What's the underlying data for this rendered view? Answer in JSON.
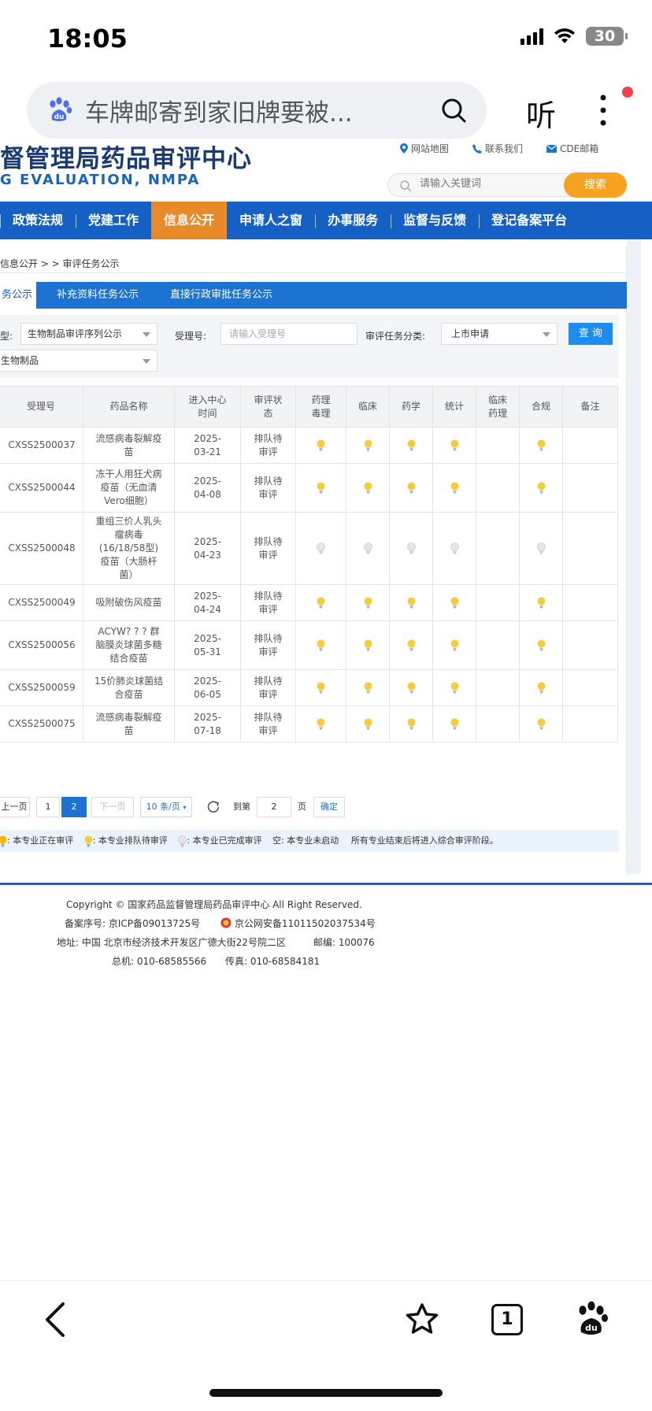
{
  "status": {
    "time": "18:05",
    "battery": "30"
  },
  "browser": {
    "search_query": "车牌邮寄到家旧牌要被...",
    "listen_label": "听"
  },
  "site": {
    "title": "督管理局药品审评中心",
    "subtitle": "G EVALUATION, NMPA",
    "links": [
      "网站地图",
      "联系我们",
      "CDE邮箱"
    ],
    "search_placeholder": "请输入关键词",
    "search_button": "搜索"
  },
  "nav": {
    "items": [
      {
        "label": "政策法规"
      },
      {
        "label": "党建工作"
      },
      {
        "label": "信息公开"
      },
      {
        "label": "申请人之窗"
      },
      {
        "label": "办事服务"
      },
      {
        "label": "监督与反馈"
      },
      {
        "label": "登记备案平台"
      }
    ]
  },
  "breadcrumb": "信息公开 > > 审评任务公示",
  "tabs": [
    "务公示",
    "补充资料任务公示",
    "直接行政审批任务公示"
  ],
  "filters": {
    "type_label": "型:",
    "type_value": "生物制品审评序列公示",
    "sub_value": "生物制品",
    "accept_label": "受理号:",
    "accept_placeholder": "请输入受理号",
    "category_label": "审评任务分类:",
    "category_value": "上市申请",
    "query_button": "查 询"
  },
  "table": {
    "headers": [
      "受理号",
      "药品名称",
      "进入中心\n时间",
      "审评状\n态",
      "药理\n毒理",
      "临床",
      "药学",
      "统计",
      "临床\n药理",
      "合规",
      "备注"
    ],
    "rows": [
      {
        "id": "CXSS2500037",
        "name": "流感病毒裂解疫\n苗",
        "date": "2025-\n03-21",
        "status": "排队待\n审评",
        "bulbs": [
          "queue",
          "queue",
          "queue",
          "queue",
          "",
          "queue"
        ]
      },
      {
        "id": "CXSS2500044",
        "name": "冻干人用狂犬病\n疫苗（无血清\nVero细胞）",
        "date": "2025-\n04-08",
        "status": "排队待\n审评",
        "bulbs": [
          "queue",
          "queue",
          "queue",
          "queue",
          "",
          "queue"
        ]
      },
      {
        "id": "CXSS2500048",
        "name": "重组三价人乳头\n瘤病毒\n(16/18/58型)\n疫苗（大肠杆\n菌）",
        "date": "2025-\n04-23",
        "status": "排队待\n审评",
        "bulbs": [
          "done",
          "done",
          "done",
          "done",
          "",
          "done"
        ]
      },
      {
        "id": "CXSS2500049",
        "name": "吸附破伤风疫苗",
        "date": "2025-\n04-24",
        "status": "排队待\n审评",
        "bulbs": [
          "queue",
          "queue",
          "queue",
          "queue",
          "",
          "queue"
        ]
      },
      {
        "id": "CXSS2500056",
        "name": "ACYW? ? ? 群\n脑膜炎球菌多糖\n结合疫苗",
        "date": "2025-\n05-31",
        "status": "排队待\n审评",
        "bulbs": [
          "queue",
          "queue",
          "queue",
          "queue",
          "",
          "queue"
        ]
      },
      {
        "id": "CXSS2500059",
        "name": "15价肺炎球菌结\n合疫苗",
        "date": "2025-\n06-05",
        "status": "排队待\n审评",
        "bulbs": [
          "queue",
          "queue",
          "queue",
          "queue",
          "",
          "queue"
        ]
      },
      {
        "id": "CXSS2500075",
        "name": "流感病毒裂解疫\n苗",
        "date": "2025-\n07-18",
        "status": "排队待\n审评",
        "bulbs": [
          "queue",
          "queue",
          "queue",
          "queue",
          "",
          "queue"
        ]
      }
    ]
  },
  "pager": {
    "prev": "上一页",
    "p1": "1",
    "p2": "2",
    "next": "下一页",
    "size": "10 条/页",
    "goto": "到第",
    "goto_value": "2",
    "page_unit": "页",
    "confirm": "确定"
  },
  "legend": {
    "active": ": 本专业正在审评",
    "queue": ": 本专业排队待审评",
    "done": ": 本专业已完成审评",
    "empty": "空: 本专业未启动",
    "note": "所有专业结束后将进入综合审评阶段。"
  },
  "footer": {
    "copyright": "Copyright © 国家药品监督管理局药品审评中心   All Right Reserved.",
    "icp": "备案序号: 京ICP备09013725号",
    "police": "京公网安备11011502037534号",
    "address": "地址: 中国 北京市经济技术开发区广德大街22号院二区",
    "postcode": "邮编: 100076",
    "phone": "总机: 010-68585566",
    "fax": "传真: 010-68584181"
  },
  "bottom_bar": {
    "tab_count": "1"
  },
  "colors": {
    "nav_blue": "#1560c4",
    "active_orange": "#e88a2a",
    "bulb_yellow": "#f5cc3b",
    "bulb_done": "#e2e2e2"
  }
}
